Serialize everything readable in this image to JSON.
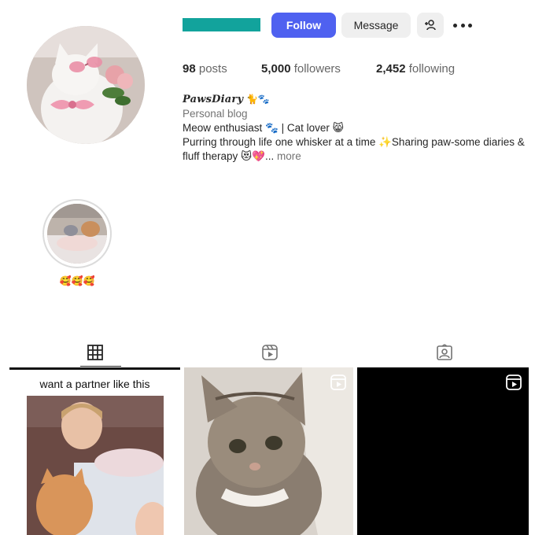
{
  "profile": {
    "follow_label": "Follow",
    "message_label": "Message",
    "stats": {
      "posts_count": "98",
      "posts_label": "posts",
      "followers_count": "5,000",
      "followers_label": "followers",
      "following_count": "2,452",
      "following_label": "following"
    },
    "bio": {
      "name": "PawsDiary",
      "name_emoji": "🐈🐾",
      "category": "Personal blog",
      "line1": "Meow enthusiast 🐾 | Cat lover 😸",
      "line2": "Purring through life one whisker at a time ✨Sharing paw-some diaries & fluff therapy 😻💖",
      "ellipsis": "...",
      "more_label": "more"
    }
  },
  "highlights": [
    {
      "label": "🥰🥰🥰"
    }
  ],
  "tabs": [
    {
      "name": "posts",
      "icon": "grid-icon",
      "active": true
    },
    {
      "name": "reels",
      "icon": "reels-icon",
      "active": false
    },
    {
      "name": "tagged",
      "icon": "tagged-icon",
      "active": false
    }
  ],
  "posts": [
    {
      "type": "image",
      "caption": "want a partner like this"
    },
    {
      "type": "reel"
    },
    {
      "type": "reel"
    }
  ],
  "colors": {
    "accent": "#4f61f0",
    "username_redaction": "#12a39c"
  }
}
